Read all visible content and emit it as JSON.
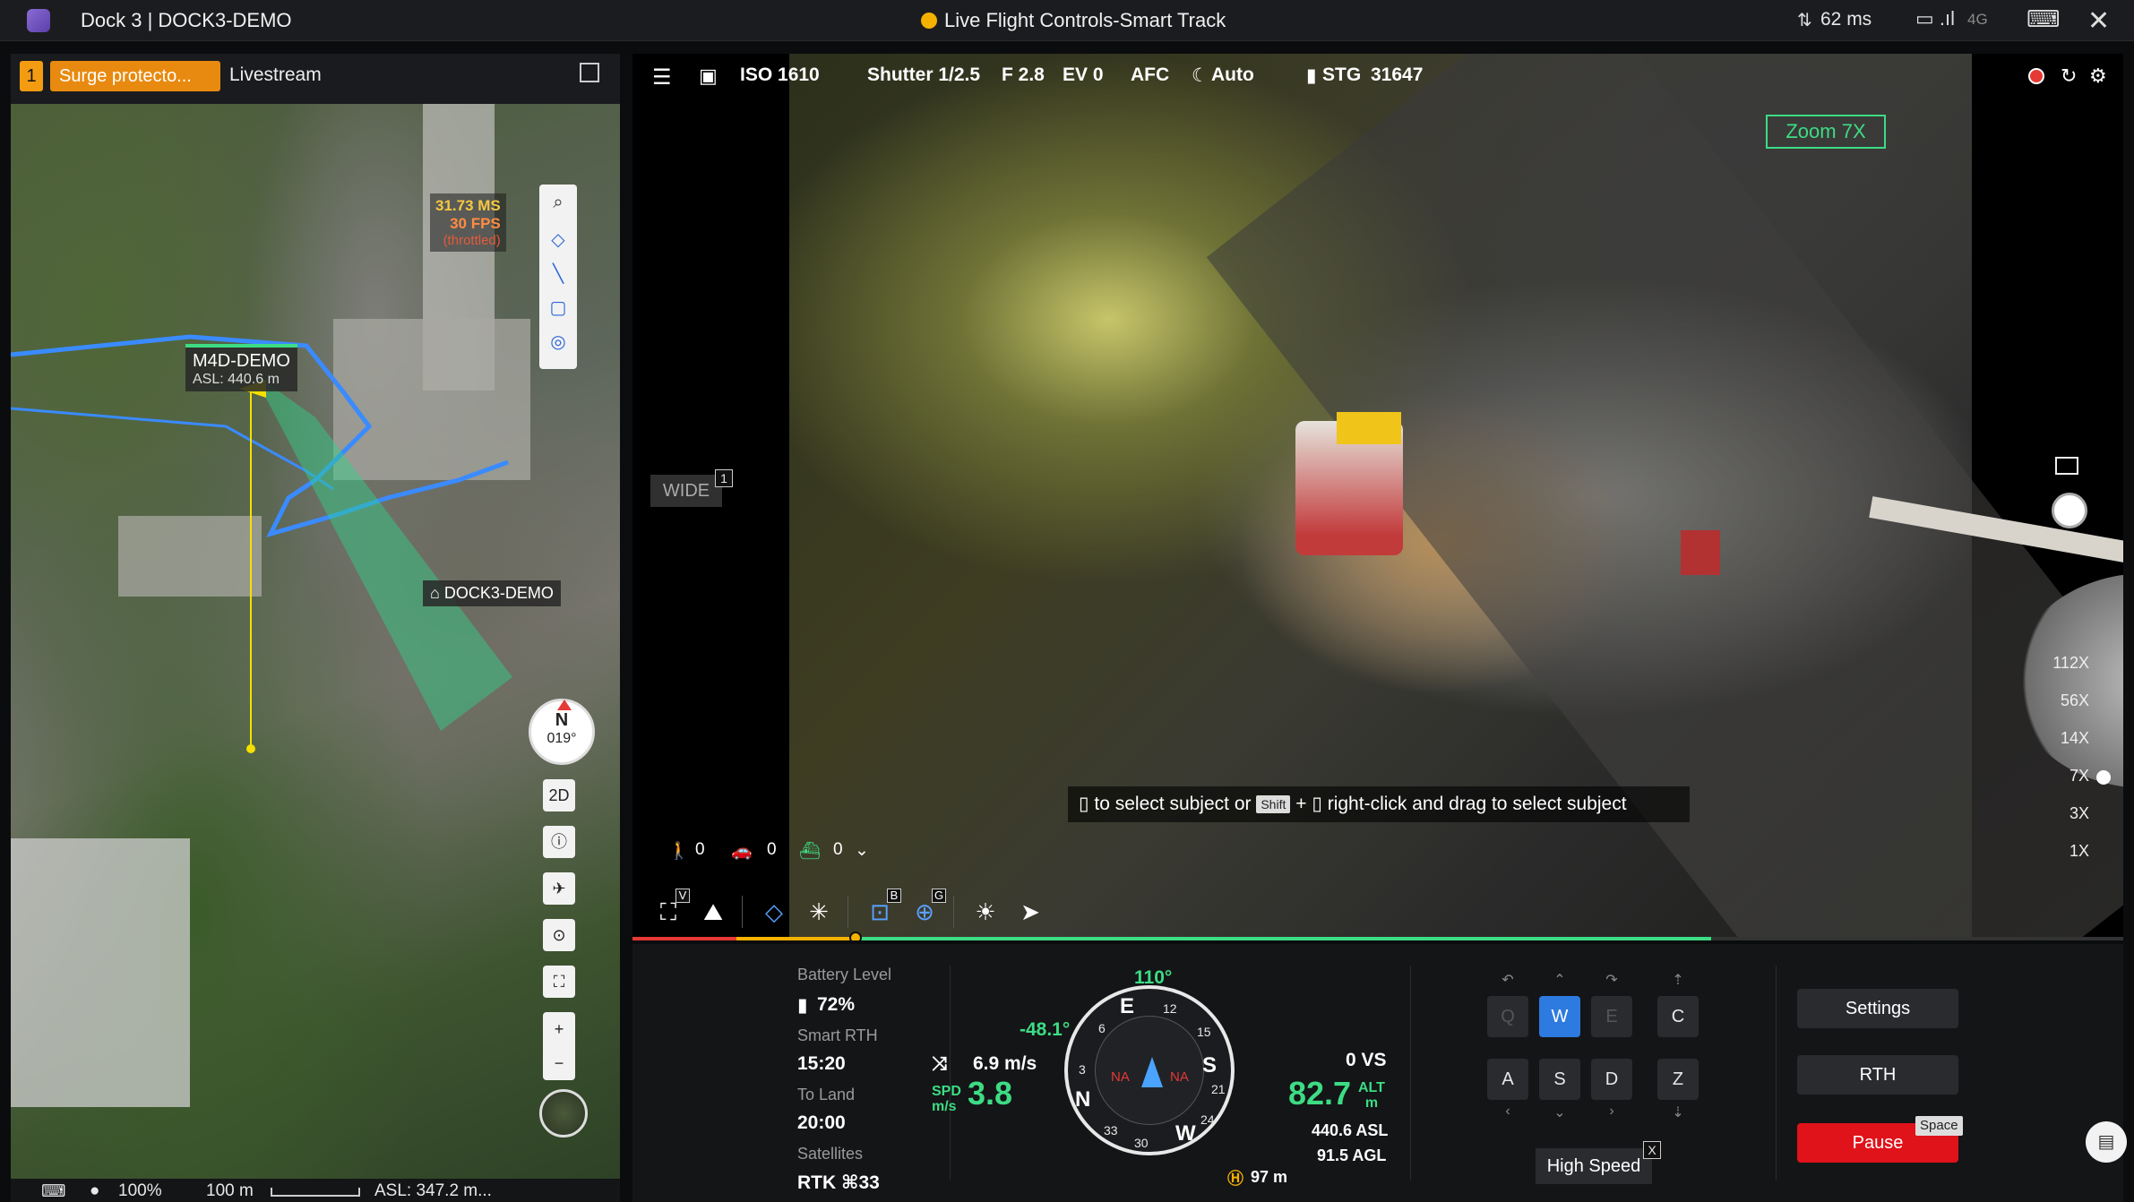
{
  "window": {
    "title": "Dock 3 | DOCK3-DEMO",
    "mode": "Live Flight Controls-Smart Track",
    "latency": "62 ms",
    "net": "4G"
  },
  "left_panel": {
    "badge": "1",
    "alert": "Surge protecto...",
    "tab": "Livestream",
    "fps_ms": "31.73 MS",
    "fps": "30 FPS",
    "throttled": "(throttled)",
    "aircraft_name": "M4D-DEMO",
    "aircraft_asl": "ASL: 440.6 m",
    "dock_name": "DOCK3-DEMO",
    "compass_n": "N",
    "compass_deg": "019°",
    "view_2d": "2D",
    "zoom_in": "+",
    "zoom_out": "−",
    "status": {
      "percent": "100%",
      "scale": "100 m",
      "asl": "ASL: 347.2 m..."
    }
  },
  "camera": {
    "iso": "ISO 1610",
    "shutter": "Shutter 1/2.5",
    "f": "F 2.8",
    "ev": "EV 0",
    "focus": "AFC",
    "wb": "Auto",
    "storage": "STG",
    "storage_value": "31647",
    "zoom_label": "Zoom 7X",
    "wide": "WIDE",
    "wide_key": "1",
    "hint_pre": "to select subject or",
    "hint_shift": "Shift",
    "hint_post": "right-click and drag to select subject",
    "zoom_levels": [
      "112X",
      "56X",
      "14X",
      "7X",
      "3X",
      "1X"
    ],
    "counters": {
      "person": "0",
      "car": "0",
      "boat": "0"
    },
    "tool_keys": {
      "v": "V",
      "b": "B",
      "g": "G"
    }
  },
  "telemetry": {
    "battery_label": "Battery Level",
    "battery": "72%",
    "smart_rth_label": "Smart RTH",
    "smart_rth": "15:20",
    "to_land_label": "To Land",
    "to_land": "20:00",
    "satellites_label": "Satellites",
    "satellites": "RTK ⌘33",
    "heading": "110°",
    "pitch": "-48.1°",
    "wind": "6.9 m/s",
    "spd_label": "SPD",
    "spd_unit": "m/s",
    "spd": "3.8",
    "vs": "0 VS",
    "alt_label": "ALT",
    "alt_unit": "m",
    "alt": "82.7",
    "asl": "440.6 ASL",
    "agl": "91.5 AGL",
    "home_dist": "97 m",
    "compass_na_left": "NA",
    "compass_na_right": "NA",
    "compass_dirs": {
      "e": "E",
      "s": "S",
      "w": "W",
      "n": "N"
    },
    "compass_ticks": [
      "12",
      "15",
      "21",
      "24",
      "3",
      "33",
      "30",
      "6"
    ]
  },
  "keys": {
    "q": "Q",
    "w": "W",
    "e": "E",
    "c": "C",
    "a": "A",
    "s": "S",
    "d": "D",
    "z": "Z",
    "high_speed": "High Speed",
    "x": "X"
  },
  "actions": {
    "settings": "Settings",
    "rth": "RTH",
    "pause": "Pause",
    "space": "Space"
  }
}
